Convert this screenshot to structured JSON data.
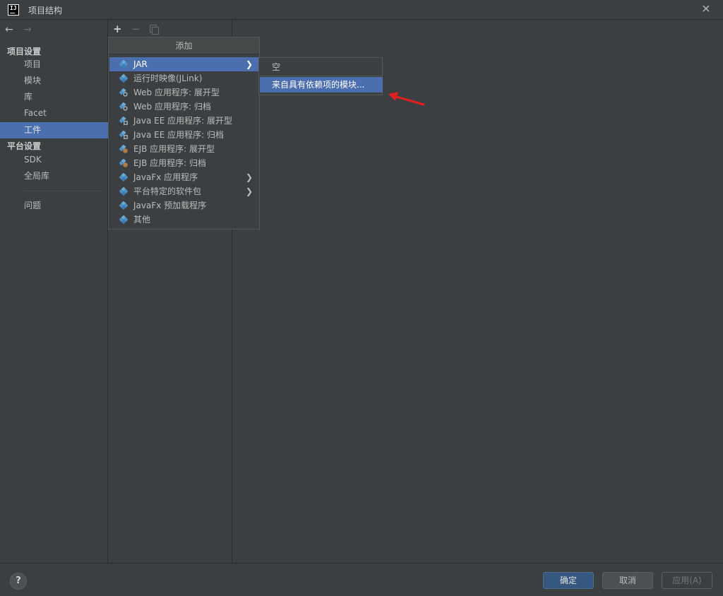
{
  "window": {
    "title": "项目结构"
  },
  "nav": {
    "back": "←",
    "forward": "→"
  },
  "sidebar": {
    "section_project": "项目设置",
    "project_items": [
      {
        "label": "项目"
      },
      {
        "label": "模块"
      },
      {
        "label": "库"
      },
      {
        "label": "Facet"
      },
      {
        "label": "工件",
        "selected": true
      }
    ],
    "section_platform": "平台设置",
    "platform_items": [
      {
        "label": "SDK"
      },
      {
        "label": "全局库"
      }
    ],
    "problems": "问题"
  },
  "toolbar": {
    "add": "+",
    "remove": "−"
  },
  "popup": {
    "header": "添加",
    "items": [
      {
        "label": "JAR",
        "has_submenu": true,
        "active": true,
        "icon": "artifact-diamond-icon"
      },
      {
        "label": "运行时映像(JLink)",
        "icon": "artifact-diamond-icon"
      },
      {
        "label": "Web 应用程序: 展开型",
        "icon": "web-artifact-icon"
      },
      {
        "label": "Web 应用程序: 归档",
        "icon": "web-artifact-icon"
      },
      {
        "label": "Java EE 应用程序: 展开型",
        "icon": "javaee-artifact-icon"
      },
      {
        "label": "Java EE 应用程序: 归档",
        "icon": "javaee-artifact-icon"
      },
      {
        "label": "EJB 应用程序: 展开型",
        "icon": "ejb-artifact-icon"
      },
      {
        "label": "EJB 应用程序: 归档",
        "icon": "ejb-artifact-icon"
      },
      {
        "label": "JavaFx 应用程序",
        "has_submenu": true,
        "icon": "artifact-diamond-icon"
      },
      {
        "label": "平台特定的软件包",
        "has_submenu": true,
        "icon": "artifact-diamond-icon"
      },
      {
        "label": "JavaFx 预加载程序",
        "icon": "artifact-diamond-icon"
      },
      {
        "label": "其他",
        "icon": "artifact-diamond-icon"
      }
    ]
  },
  "submenu": {
    "items": [
      {
        "label": "空"
      },
      {
        "label": "来自具有依赖项的模块...",
        "active": true
      }
    ]
  },
  "buttons": {
    "help": "?",
    "ok": "确定",
    "cancel": "取消",
    "apply": "应用(A)"
  },
  "colors": {
    "selection": "#4b6eaf",
    "background": "#3c3f41",
    "annotation_arrow": "#e02020"
  }
}
